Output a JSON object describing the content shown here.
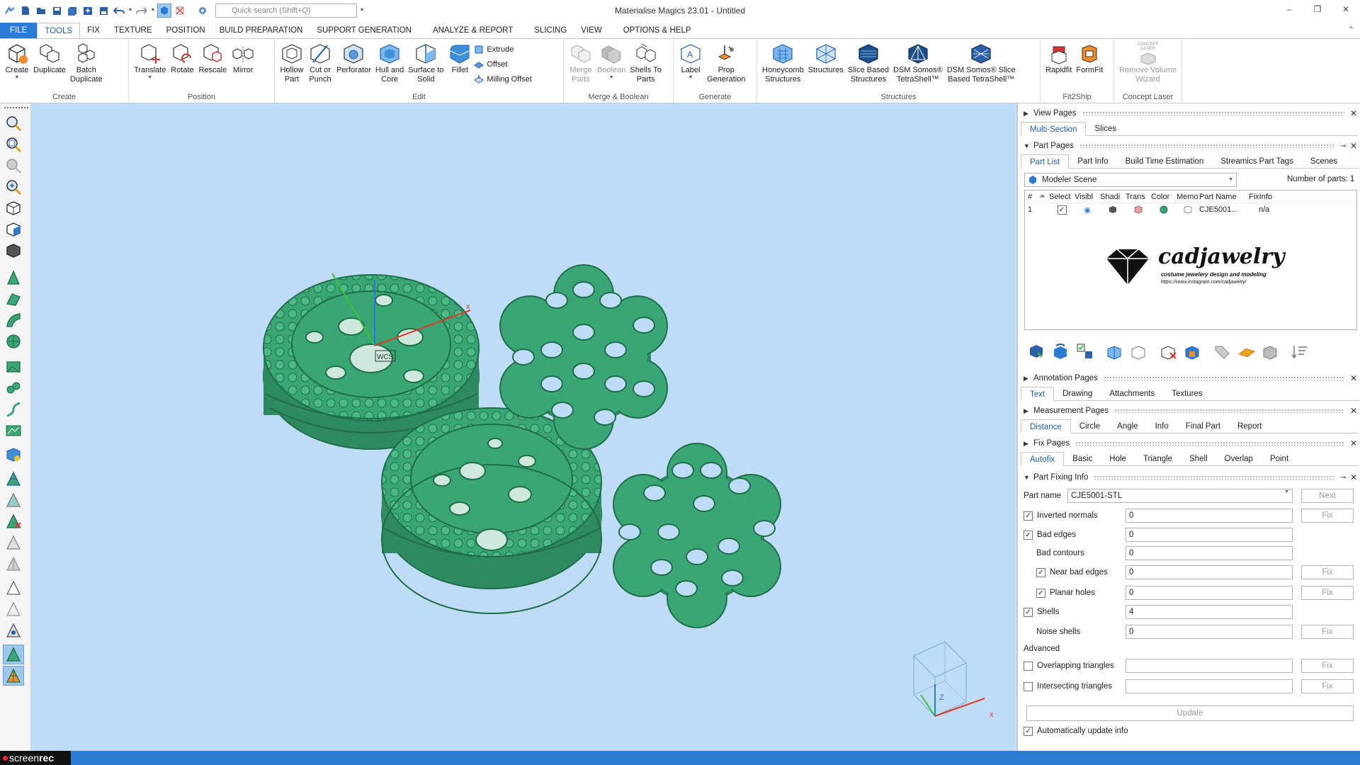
{
  "window": {
    "title": "Materialise Magics 23.01 - Untitled",
    "search_placeholder": "Quick search (Shift+Q)",
    "minimize": "–",
    "maximize": "❐",
    "close": "✕"
  },
  "menu": {
    "tabs": [
      "FILE",
      "TOOLS",
      "FIX",
      "TEXTURE",
      "POSITION",
      "BUILD PREPARATION",
      "SUPPORT GENERATION",
      "ANALYZE & REPORT",
      "SLICING",
      "VIEW",
      "OPTIONS & HELP"
    ],
    "active": "TOOLS"
  },
  "ribbon": {
    "create": {
      "label": "Create",
      "buttons": [
        "Create",
        "Duplicate",
        "Batch\nDuplicate"
      ]
    },
    "position": {
      "label": "Position",
      "buttons": [
        "Translate",
        "Rotate",
        "Rescale",
        "Mirror"
      ]
    },
    "edit": {
      "label": "Edit",
      "buttons": [
        "Hollow\nPart",
        "Cut or\nPunch",
        "Perforator",
        "Hull and\nCore",
        "Surface to\nSolid",
        "Fillet"
      ],
      "small": [
        "Extrude",
        "Offset",
        "Milling Offset"
      ]
    },
    "merge": {
      "label": "Merge & Boolean",
      "buttons": [
        "Merge\nParts",
        "Boolean",
        "Shells To\nParts"
      ]
    },
    "generate": {
      "label": "Generate",
      "buttons": [
        "Label",
        "Prop\nGeneration"
      ]
    },
    "structures": {
      "label": "Structures",
      "buttons": [
        "Honeycomb\nStructures",
        "Structures",
        "Slice Based\nStructures",
        "DSM Somos®\nTetraShell™",
        "DSM Somos® Slice\nBased TetraShell™"
      ]
    },
    "fit2ship": {
      "label": "Fit2Ship",
      "buttons": [
        "Rapidfit",
        "FormFit"
      ]
    },
    "concept": {
      "label": "Concept Laser",
      "buttons": [
        "Remove Volume\nWizard"
      ],
      "icon_text": "CONCEPT\nLASER"
    }
  },
  "right_panel": {
    "view_pages": {
      "title": "View Pages",
      "tabs": [
        "Multi-Section",
        "Slices"
      ]
    },
    "part_pages": {
      "title": "Part Pages",
      "tabs": [
        "Part List",
        "Part Info",
        "Build Time Estimation",
        "Streamics Part Tags",
        "Scenes"
      ],
      "scene": "Modeler Scene",
      "parts_label": "Number of parts:",
      "parts_count": "1",
      "columns": [
        "#",
        "Select",
        "Visibl",
        "Shadi",
        "Trans",
        "Color",
        "Memo",
        "Part Name",
        "FixInfo"
      ],
      "row": {
        "num": "1",
        "name": "CJE5001...",
        "fixinfo": "n/a"
      },
      "logo": {
        "brand": "cadjawelry",
        "tagline": "costume jewelery design and modeling",
        "url": "https://www.instagram.com/cadjawelry/"
      }
    },
    "annotation_pages": {
      "title": "Annotation Pages",
      "tabs": [
        "Text",
        "Drawing",
        "Attachments",
        "Textures"
      ]
    },
    "measurement_pages": {
      "title": "Measurement Pages",
      "tabs": [
        "Distance",
        "Circle",
        "Angle",
        "Info",
        "Final Part",
        "Report"
      ]
    },
    "fix_pages": {
      "title": "Fix Pages",
      "tabs": [
        "Autofix",
        "Basic",
        "Hole",
        "Triangle",
        "Shell",
        "Overlap",
        "Point"
      ]
    },
    "part_fixing": {
      "title": "Part Fixing Info",
      "part_name_label": "Part name",
      "part_name": "CJE5001-STL",
      "next": "Next",
      "fix": "Fix",
      "rows": {
        "inverted_normals": {
          "label": "Inverted normals",
          "value": "0"
        },
        "bad_edges": {
          "label": "Bad edges",
          "value": "0"
        },
        "bad_contours": {
          "label": "Bad contours",
          "value": "0"
        },
        "near_bad_edges": {
          "label": "Near bad edges",
          "value": "0"
        },
        "planar_holes": {
          "label": "Planar holes",
          "value": "0"
        },
        "shells": {
          "label": "Shells",
          "value": "4"
        },
        "noise_shells": {
          "label": "Noise shells",
          "value": "0"
        }
      },
      "advanced": "Advanced",
      "overlapping": "Overlapping triangles",
      "intersecting": "Intersecting triangles",
      "update": "Update",
      "auto_update": "Automatically update info"
    }
  },
  "viewport": {
    "axis_x": "x",
    "axis_z": "Z",
    "wcs": "WCS"
  },
  "statusbar": {
    "rec_a": "screen",
    "rec_b": "rec"
  },
  "colors": {
    "accent": "#2b7ad3",
    "viewport_bg": "#bfdcf6",
    "model": "#3aa675",
    "model_dark": "#1f6e4a"
  }
}
